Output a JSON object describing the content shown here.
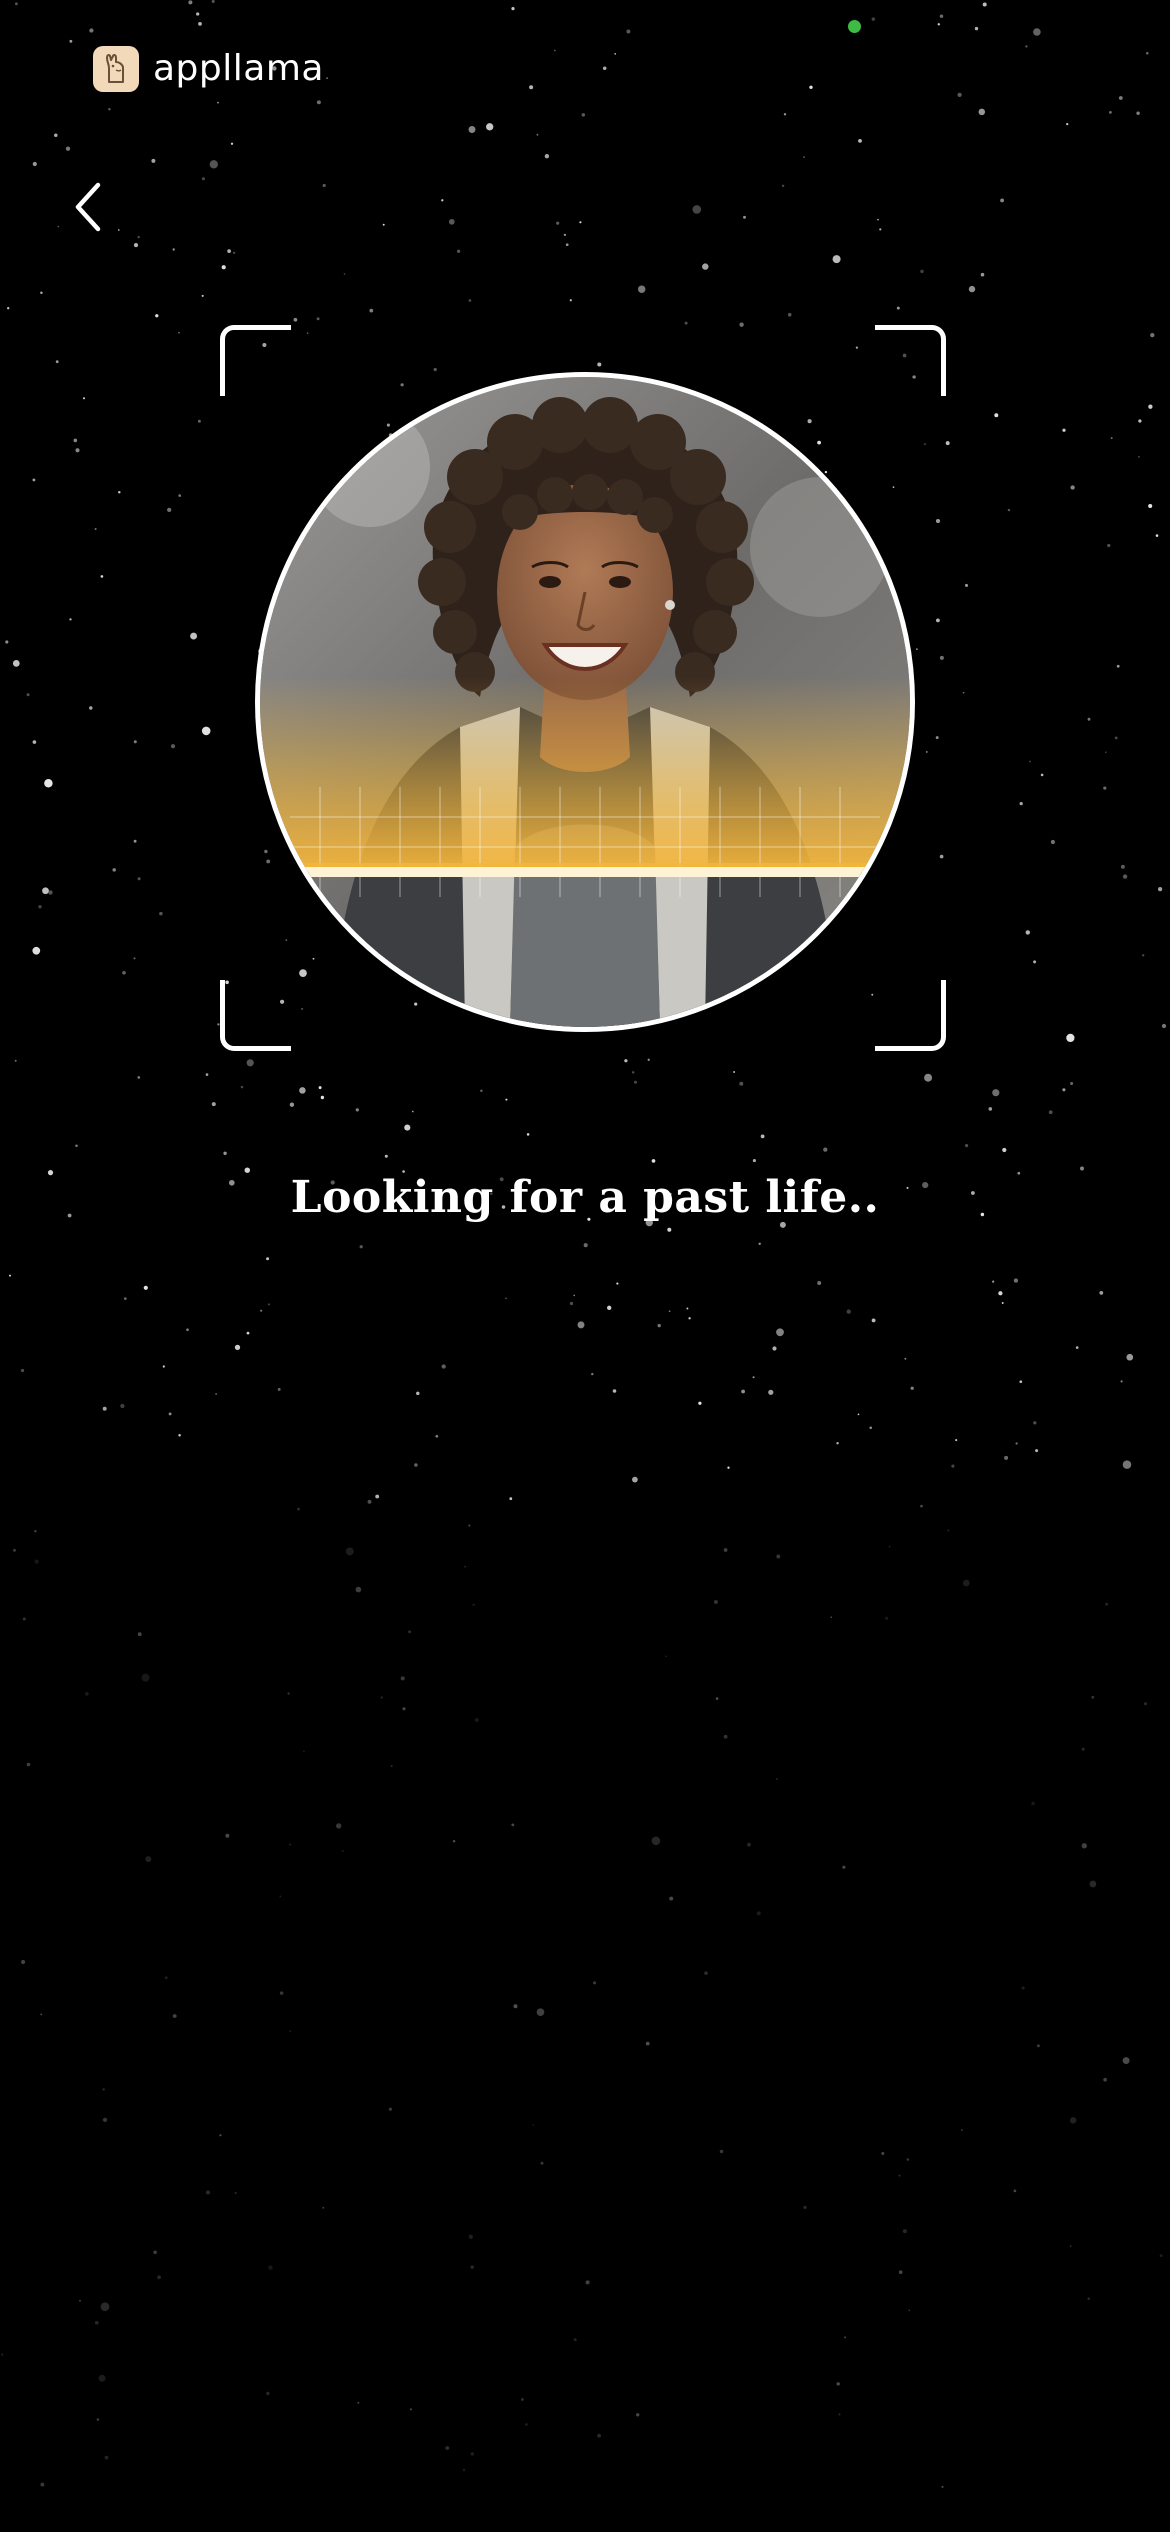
{
  "status_bar": {
    "indicator_color": "#3dbb45"
  },
  "brand": {
    "name": "appllama",
    "logo_icon": "llama-icon",
    "logo_color": "#f1d9b9"
  },
  "nav": {
    "back_icon": "chevron-left-icon"
  },
  "scanner": {
    "frame_icon": "scan-corner-brackets",
    "scan_line_color": "#f2b63a",
    "status_text": "Looking for a past life.."
  },
  "theme": {
    "background": "#000000",
    "text": "#ffffff"
  }
}
